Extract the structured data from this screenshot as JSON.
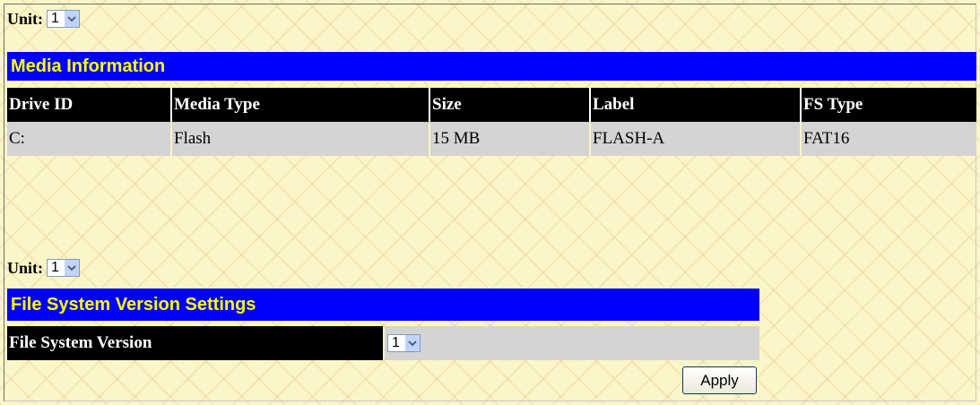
{
  "unit_selector_1": {
    "label": "Unit:",
    "value": "1"
  },
  "media_section": {
    "title": "Media Information",
    "columns": [
      "Drive ID",
      "Media Type",
      "Size",
      "Label",
      "FS Type"
    ],
    "rows": [
      [
        "C:",
        "Flash",
        "15 MB",
        "FLASH-A",
        "FAT16"
      ]
    ]
  },
  "unit_selector_2": {
    "label": "Unit:",
    "value": "1"
  },
  "fs_version_section": {
    "title": "File System Version Settings",
    "field_label": "File System Version",
    "field_value": "1",
    "apply_label": "Apply"
  },
  "colors": {
    "header_bar": "#0000ff",
    "header_text": "#ffff00",
    "column_header_bg": "#000000",
    "row_bg": "#d4d4d4",
    "page_bg": "#fbf5c8"
  },
  "icons": {
    "dropdown": "chevron-down-icon"
  }
}
